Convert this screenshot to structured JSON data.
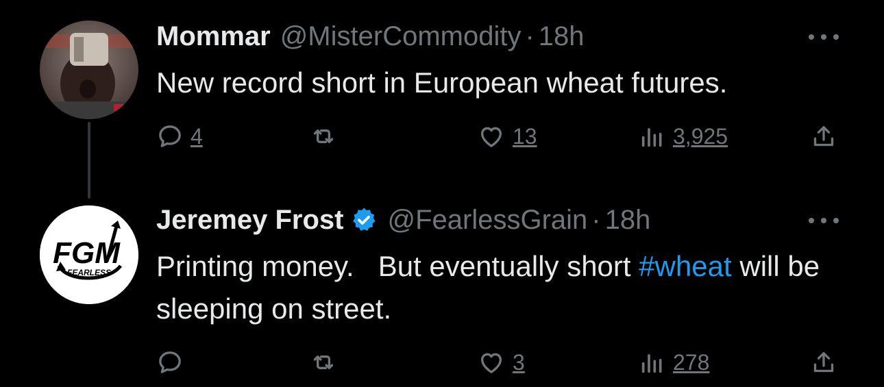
{
  "tweets": [
    {
      "name": "Mommar",
      "handle": "@MisterCommodity",
      "dot": "·",
      "time": "18h",
      "text": "New record short in European wheat futures.",
      "replies": "4",
      "retweets": "",
      "likes": "13",
      "views": "3,925",
      "avatar": "photo-avatar",
      "verified": false
    },
    {
      "name": "Jeremey Frost",
      "handle": "@FearlessGrain",
      "dot": "·",
      "time": "18h",
      "text_before": "Printing money.   But eventually short ",
      "hashtag": "#wheat",
      "text_after": " will be sleeping on street.",
      "replies": "",
      "retweets": "",
      "likes": "3",
      "views": "278",
      "avatar": "fgm-logo-avatar",
      "avatar_logo_text": "FGM",
      "avatar_logo_subtext": "FEARLESS",
      "verified": true
    }
  ],
  "colors": {
    "background": "#000000",
    "text": "#e7e9ea",
    "muted": "#71767b",
    "accent": "#1d9bf0",
    "thread_line": "#333639"
  },
  "icons": [
    "reply-icon",
    "retweet-icon",
    "like-icon",
    "views-icon",
    "share-icon",
    "more-icon",
    "verified-badge-icon"
  ]
}
